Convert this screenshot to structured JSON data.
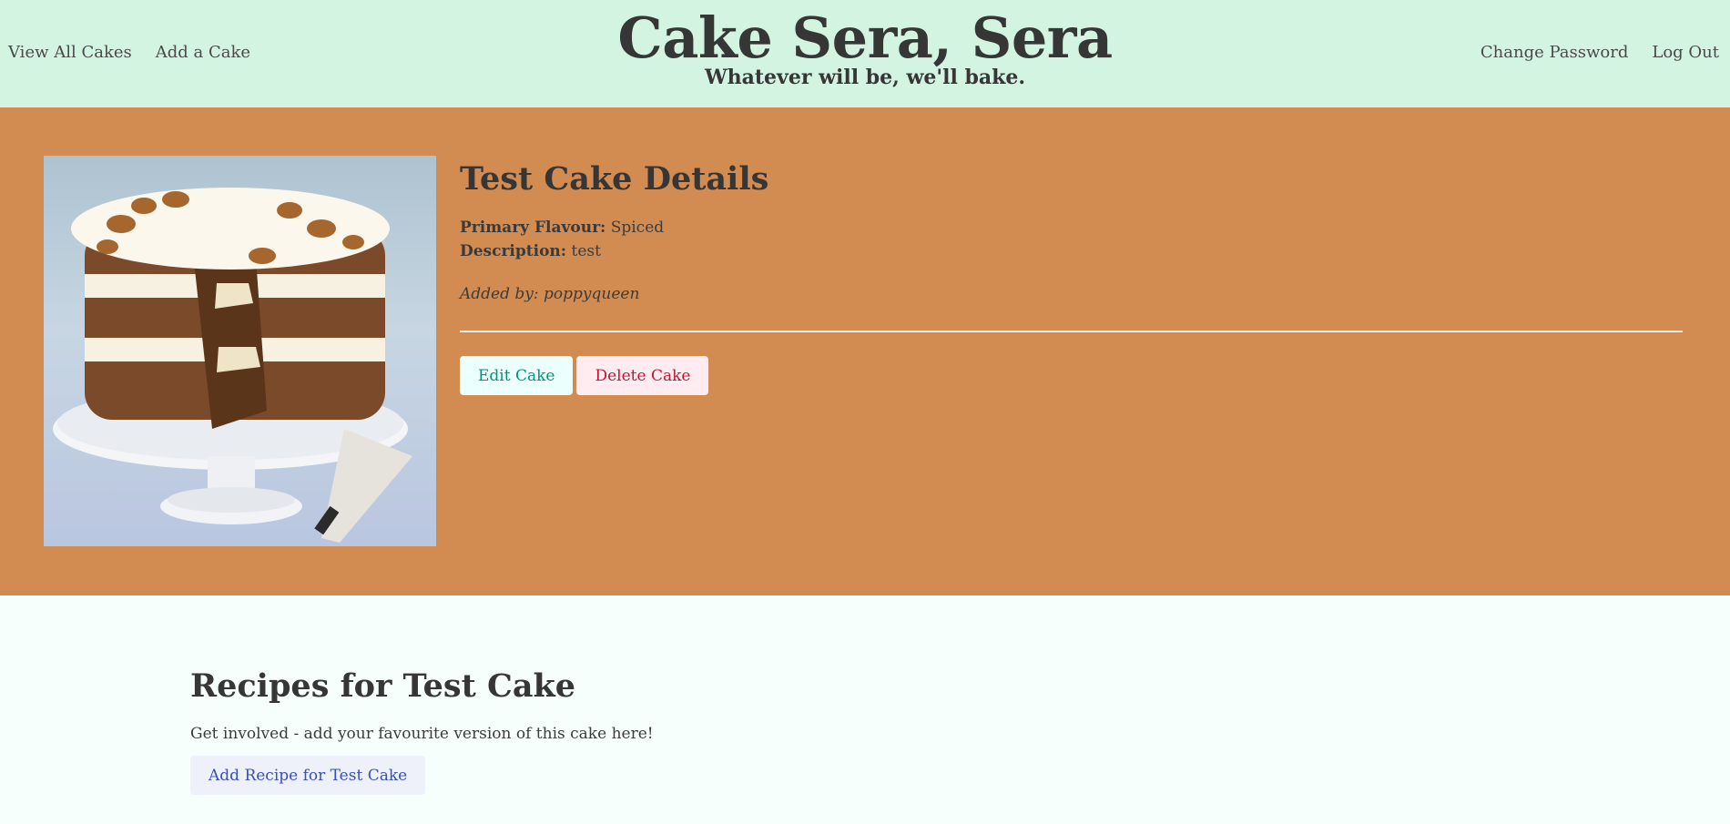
{
  "nav": {
    "left": [
      "View All Cakes",
      "Add a Cake"
    ],
    "right": [
      "Change Password",
      "Log Out"
    ]
  },
  "brand": {
    "title": "Cake Sera, Sera",
    "subtitle": "Whatever will be, we'll bake."
  },
  "cake": {
    "heading": "Test Cake Details",
    "flavour_label": "Primary Flavour:",
    "flavour_value": "Spiced",
    "description_label": "Description:",
    "description_value": "test",
    "added_by": "Added by: poppyqueen",
    "edit_label": "Edit Cake",
    "delete_label": "Delete Cake"
  },
  "recipes": {
    "heading": "Recipes for Test Cake",
    "prompt": "Get involved - add your favourite version of this cake here!",
    "add_label": "Add Recipe for Test Cake"
  },
  "colors": {
    "header_bg": "#d2f4e0",
    "hero_bg": "#d28b51",
    "page_bg": "#f7fffd",
    "edit_text": "#00947e",
    "delete_text": "#cc0f35",
    "add_text": "#3850b7"
  }
}
